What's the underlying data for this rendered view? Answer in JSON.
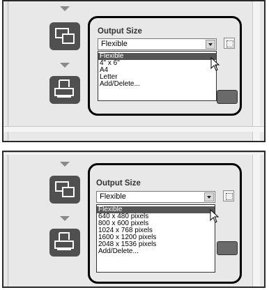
{
  "panels": [
    {
      "output_size_label": "Output Size",
      "selected_value": "Flexible",
      "options": [
        "Flexible",
        "4\" x 6\"",
        "A4",
        "Letter",
        "Add/Delete..."
      ],
      "highlighted_index": 0
    },
    {
      "output_size_label": "Output Size",
      "selected_value": "Flexible",
      "options": [
        "Flexible",
        "640 x 480 pixels",
        "800 x 600 pixels",
        "1024 x 768 pixels",
        "1600 x 1200 pixels",
        "2048 x 1536 pixels",
        "Add/Delete..."
      ],
      "highlighted_index": 0
    }
  ],
  "icons": {
    "resize": "resize-windows-icon",
    "print": "print-icon",
    "flow_arrow": "down-arrow-icon",
    "crop": "crop-icon",
    "dropdown": "chevron-down-icon",
    "cursor": "mouse-pointer-icon"
  },
  "colors": {
    "panel_bg": "#e8e8e8",
    "icon_bg": "#505050",
    "highlight": "#555555"
  }
}
